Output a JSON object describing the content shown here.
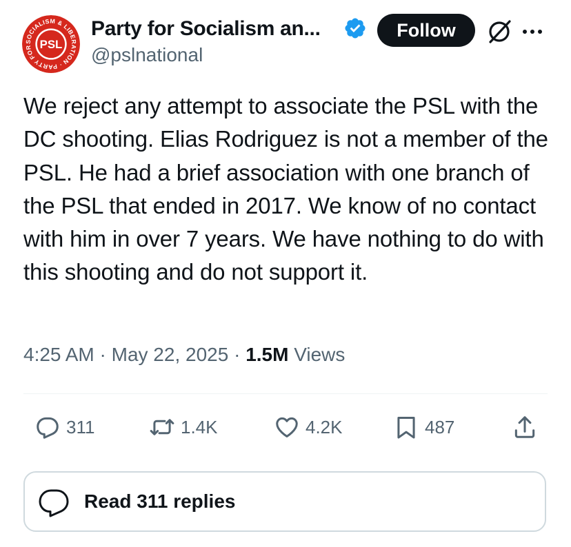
{
  "author": {
    "name": "Party for Socialism an...",
    "handle": "@pslnational",
    "avatar": {
      "logo_text": "PSL",
      "ring_text": "SOCIALISM & LIBERATION · PARTY FOR ·",
      "color": "#d5281d"
    },
    "verified": true
  },
  "header_actions": {
    "follow_label": "Follow",
    "grok_icon": "grok-icon",
    "more_icon": "more-icon"
  },
  "post": {
    "text": "We reject any attempt to associate the PSL with the DC shooting. Elias Rodriguez is not a member of the PSL. He had a brief association with one branch of the PSL that ended in 2017. We know of no contact with him in over 7 years. We have nothing to do with this shooting and do not support it.",
    "time": "4:25 AM",
    "separator": "·",
    "date": "May 22, 2025",
    "views_count": "1.5M",
    "views_label": "Views"
  },
  "engagement": {
    "replies": "311",
    "reposts": "1.4K",
    "likes": "4.2K",
    "bookmarks": "487"
  },
  "read_replies": {
    "label": "Read 311 replies"
  },
  "colors": {
    "text": "#0f1419",
    "secondary": "#536471",
    "verified": "#1d9bf0",
    "follow_bg": "#0f1419",
    "border": "#cfd9de"
  }
}
